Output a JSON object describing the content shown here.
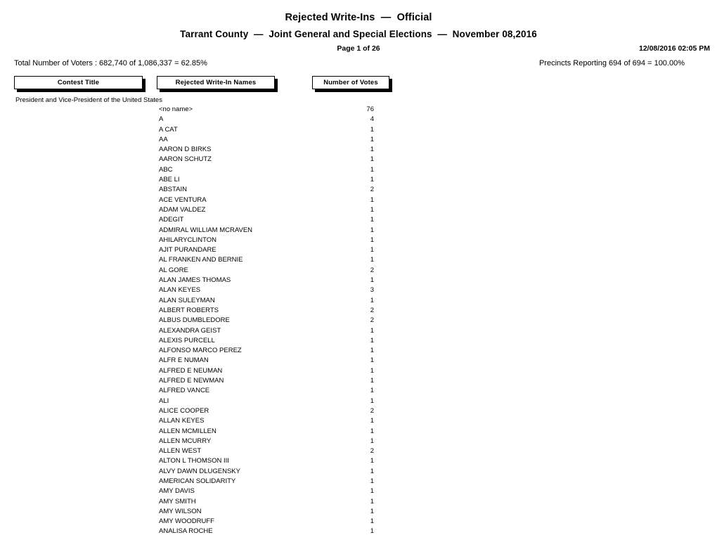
{
  "header": {
    "title_line_1": "Rejected Write-Ins  —  Official",
    "title_line_2": "Tarrant County  —  Joint General and Special Elections  —  November 08,2016",
    "page_indicator": "Page 1 of 26",
    "timestamp": "12/08/2016 02:05 PM",
    "voters_total": "Total Number of Voters : 682,740 of 1,086,337 = 62.85%",
    "precincts_reporting": "Precincts Reporting 694 of 694 = 100.00%"
  },
  "columns": {
    "contest_title": "Contest Title",
    "write_in_names": "Rejected Write-In Names",
    "number_of_votes": "Number of Votes"
  },
  "contest": {
    "title": "President and Vice-President of the United States"
  },
  "rows": [
    {
      "name": "<no name>",
      "votes": "76"
    },
    {
      "name": "A",
      "votes": "4"
    },
    {
      "name": "A CAT",
      "votes": "1"
    },
    {
      "name": "AA",
      "votes": "1"
    },
    {
      "name": "AARON D BIRKS",
      "votes": "1"
    },
    {
      "name": "AARON SCHUTZ",
      "votes": "1"
    },
    {
      "name": "ABC",
      "votes": "1"
    },
    {
      "name": "ABE LI",
      "votes": "1"
    },
    {
      "name": "ABSTAIN",
      "votes": "2"
    },
    {
      "name": "ACE VENTURA",
      "votes": "1"
    },
    {
      "name": "ADAM VALDEZ",
      "votes": "1"
    },
    {
      "name": "ADEGIT",
      "votes": "1"
    },
    {
      "name": "ADMIRAL WILLIAM MCRAVEN",
      "votes": "1"
    },
    {
      "name": "AHILARYCLINTON",
      "votes": "1"
    },
    {
      "name": "AJIT PURANDARE",
      "votes": "1"
    },
    {
      "name": "AL FRANKEN AND BERNIE",
      "votes": "1"
    },
    {
      "name": "AL GORE",
      "votes": "2"
    },
    {
      "name": "ALAN JAMES THOMAS",
      "votes": "1"
    },
    {
      "name": "ALAN KEYES",
      "votes": "3"
    },
    {
      "name": "ALAN SULEYMAN",
      "votes": "1"
    },
    {
      "name": "ALBERT ROBERTS",
      "votes": "2"
    },
    {
      "name": "ALBUS DUMBLEDORE",
      "votes": "2"
    },
    {
      "name": "ALEXANDRA GEIST",
      "votes": "1"
    },
    {
      "name": "ALEXIS PURCELL",
      "votes": "1"
    },
    {
      "name": "ALFONSO MARCO PEREZ",
      "votes": "1"
    },
    {
      "name": "ALFR E NUMAN",
      "votes": "1"
    },
    {
      "name": "ALFRED E NEUMAN",
      "votes": "1"
    },
    {
      "name": "ALFRED E NEWMAN",
      "votes": "1"
    },
    {
      "name": "ALFRED VANCE",
      "votes": "1"
    },
    {
      "name": "ALI",
      "votes": "1"
    },
    {
      "name": "ALICE COOPER",
      "votes": "2"
    },
    {
      "name": "ALLAN KEYES",
      "votes": "1"
    },
    {
      "name": "ALLEN MCMILLEN",
      "votes": "1"
    },
    {
      "name": "ALLEN MCURRY",
      "votes": "1"
    },
    {
      "name": "ALLEN WEST",
      "votes": "2"
    },
    {
      "name": "ALTON L THOMSON III",
      "votes": "1"
    },
    {
      "name": "ALVY DAWN DLUGENSKY",
      "votes": "1"
    },
    {
      "name": "AMERICAN SOLIDARITY",
      "votes": "1"
    },
    {
      "name": "AMY DAVIS",
      "votes": "1"
    },
    {
      "name": "AMY SMITH",
      "votes": "1"
    },
    {
      "name": "AMY WILSON",
      "votes": "1"
    },
    {
      "name": "AMY WOODRUFF",
      "votes": "1"
    },
    {
      "name": "ANALISA ROCHE",
      "votes": "1"
    }
  ]
}
